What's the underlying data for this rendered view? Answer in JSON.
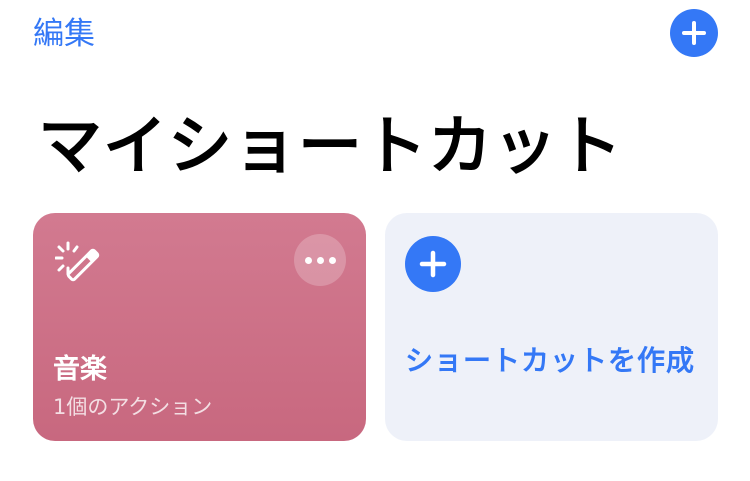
{
  "header": {
    "edit_label": "編集",
    "add_icon": "plus-icon"
  },
  "title": "マイショートカット",
  "shortcuts": [
    {
      "name": "音楽",
      "subtitle": "1個のアクション",
      "icon": "magic-wand-icon",
      "more_icon": "ellipsis-icon",
      "color": "#cc7088"
    }
  ],
  "create_card": {
    "label": "ショートカットを作成",
    "icon": "plus-icon"
  },
  "colors": {
    "accent": "#3478f6",
    "shortcut_card": "#cc7088",
    "create_card_bg": "#eef1f9"
  }
}
